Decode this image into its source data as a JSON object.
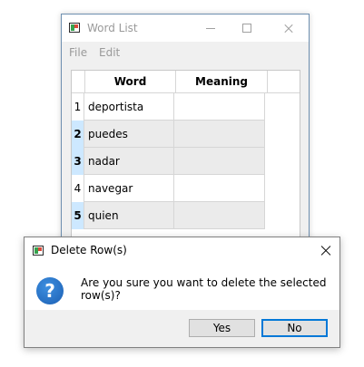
{
  "main_window": {
    "title": "Word List",
    "menu": [
      "File",
      "Edit"
    ]
  },
  "table": {
    "columns": [
      "Word",
      "Meaning"
    ],
    "rows": [
      {
        "num": "1",
        "word": "deportista",
        "meaning": "",
        "selected": false
      },
      {
        "num": "2",
        "word": "puedes",
        "meaning": "",
        "selected": true
      },
      {
        "num": "3",
        "word": "nadar",
        "meaning": "",
        "selected": true
      },
      {
        "num": "4",
        "word": "navegar",
        "meaning": "",
        "selected": false
      },
      {
        "num": "5",
        "word": "quien",
        "meaning": "",
        "selected": true
      }
    ]
  },
  "dialog": {
    "title": "Delete Row(s)",
    "icon": "question-icon",
    "icon_glyph": "?",
    "message": "Are you sure you want to delete the selected row(s)?",
    "yes_label": "Yes",
    "no_label": "No"
  },
  "colors": {
    "selection_header": "#cde8ff",
    "selection_cell": "#ebebeb",
    "default_button_border": "#0078d7"
  }
}
